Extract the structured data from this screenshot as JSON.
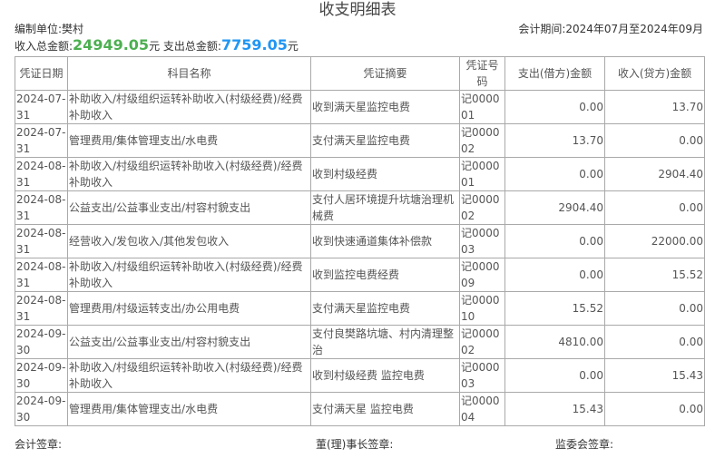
{
  "title": "收支明细表",
  "unit": {
    "label": "编制单位:",
    "value": "樊村"
  },
  "period": {
    "label": "会计期间:",
    "start": "2024年07月",
    "to": "至",
    "end": "2024年09月"
  },
  "totals": {
    "income_label": "收入总金额:",
    "income_value": "24949.05",
    "income_unit": "元",
    "expense_label": "支出总金额:",
    "expense_value": "7759.05",
    "expense_unit": "元"
  },
  "columns": [
    "凭证日期",
    "科目名称",
    "凭证摘要",
    "凭证号码",
    "支出(借方)金额",
    "收入(贷方)金额"
  ],
  "rows": [
    {
      "date": "2024-07-31",
      "subject": "补助收入/村级组织运转补助收入(村级经费)/经费补助收入",
      "summary": "收到满天星监控电费",
      "code": "记000001",
      "debit": "0.00",
      "credit": "13.70"
    },
    {
      "date": "2024-07-31",
      "subject": "管理费用/集体管理支出/水电费",
      "summary": "支付满天星监控电费",
      "code": "记000002",
      "debit": "13.70",
      "credit": "0.00"
    },
    {
      "date": "2024-08-31",
      "subject": "补助收入/村级组织运转补助收入(村级经费)/经费补助收入",
      "summary": "收到村级经费",
      "code": "记000001",
      "debit": "0.00",
      "credit": "2904.40"
    },
    {
      "date": "2024-08-31",
      "subject": "公益支出/公益事业支出/村容村貌支出",
      "summary": "支付人居环境提升坑塘治理机械费",
      "code": "记000002",
      "debit": "2904.40",
      "credit": "0.00"
    },
    {
      "date": "2024-08-31",
      "subject": "经营收入/发包收入/其他发包收入",
      "summary": "收到快速通道集体补偿款",
      "code": "记000003",
      "debit": "0.00",
      "credit": "22000.00"
    },
    {
      "date": "2024-08-31",
      "subject": "补助收入/村级组织运转补助收入(村级经费)/经费补助收入",
      "summary": "收到监控电费经费",
      "code": "记000009",
      "debit": "0.00",
      "credit": "15.52"
    },
    {
      "date": "2024-08-31",
      "subject": "管理费用/村级运转支出/办公用电费",
      "summary": "支付满天星监控电费",
      "code": "记000010",
      "debit": "15.52",
      "credit": "0.00"
    },
    {
      "date": "2024-09-30",
      "subject": "公益支出/公益事业支出/村容村貌支出",
      "summary": "支付良樊路坑塘、村内清理整治",
      "code": "记000002",
      "debit": "4810.00",
      "credit": "0.00"
    },
    {
      "date": "2024-09-30",
      "subject": "补助收入/村级组织运转补助收入(村级经费)/经费补助收入",
      "summary": "收到村级经费 监控电费",
      "code": "记000003",
      "debit": "0.00",
      "credit": "15.43"
    },
    {
      "date": "2024-09-30",
      "subject": "管理费用/集体管理支出/水电费",
      "summary": "支付满天星 监控电费",
      "code": "记000004",
      "debit": "15.43",
      "credit": "0.00"
    }
  ],
  "footer": {
    "accountant": "会计签章:",
    "director": "董(理)事长签章:",
    "supervisor": "监委会签章:"
  },
  "colors": {
    "income": "#4caf50",
    "expense": "#2196f3",
    "border": "#a9a9a9"
  }
}
